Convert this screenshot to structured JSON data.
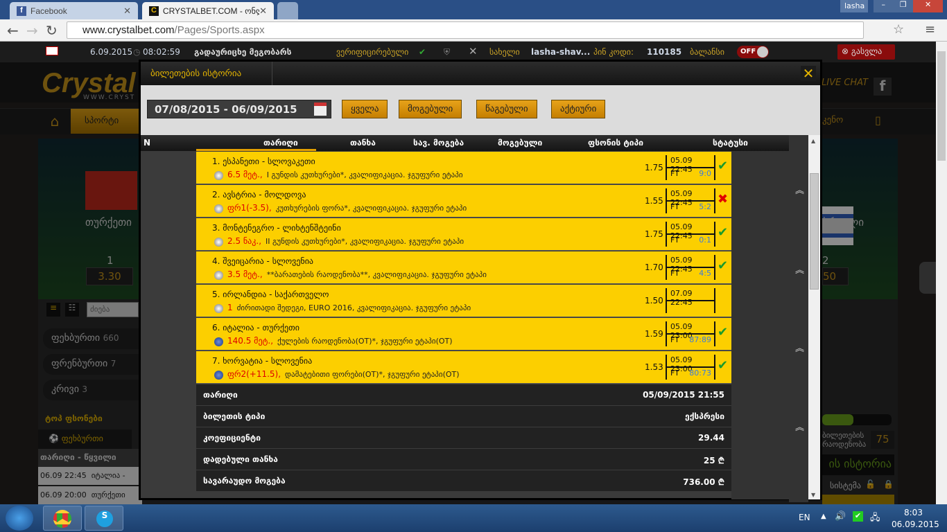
{
  "browser": {
    "tabs": [
      {
        "title": "Facebook"
      },
      {
        "title": "CRYSTALBET.COM - ონლ..."
      }
    ],
    "url_host": "www.crystalbet.com",
    "url_path": "/Pages/Sports.aspx",
    "user": "lasha"
  },
  "topbar": {
    "date": "6.09.2015",
    "time": "08:02:59",
    "transfer": "გადაურიცხე მეგობარს",
    "verified": "ვერიფიცირებული",
    "name_label": "სახელი",
    "username": "lasha-shav...",
    "pin_label": "პინ კოდი:",
    "pin": "110185",
    "balance_label": "ბალანსი",
    "balance_toggle": "OFF",
    "logout": "გასვლა"
  },
  "site": {
    "logo": "Crystal",
    "logo_sub": "WWW.CRYST",
    "nav_sport": "სპორტი",
    "nav_casino": "კენო",
    "live_chat": "LIVE CHAT",
    "team1": "თურქეთი",
    "team2": "ისრაელი",
    "odd1_label": "1",
    "odd1": "3.30",
    "odd2_label": "2",
    "odd2": "50",
    "search_placeholder": "ძიება",
    "sports": [
      {
        "name": "ფეხბურთი",
        "count": "660"
      },
      {
        "name": "ფრენბურთი",
        "count": "7"
      },
      {
        "name": "კრივი",
        "count": "3"
      }
    ],
    "top_events": "ტოპ ფსონები",
    "top_tab": "ფეხბურთი",
    "top_header": "თარიღი - წყვილი",
    "top_rows": [
      {
        "time": "06.09 22:45",
        "match": "იტალია -"
      },
      {
        "time": "06.09 20:00",
        "match": "თურქეთი"
      }
    ],
    "tickets_count_label": "ბილეთების რაოდენობა",
    "tickets_count": "75",
    "history_banner": "ის ისტორია",
    "system_tab": "სისტემა"
  },
  "modal": {
    "title": "ბილეთების ისტორია",
    "date_range": "07/08/2015 - 06/09/2015",
    "filters": [
      "ყველა",
      "მოგებული",
      "წაგებული",
      "აქტიური"
    ],
    "columns": [
      "N",
      "თარიღი",
      "თანხა",
      "სავ. მოგება",
      "მოგებული",
      "ფსონის ტიპი",
      "სტატუსი"
    ],
    "bets": [
      {
        "match": "1. ესპანეთი - სლოვაკეთი",
        "bet": "6.5 მეტ.,",
        "desc": "I გუნდის კუთხურები*, კვალიფიკაცია. ჯგუფური ეტაპი",
        "sport": "football",
        "odds": "1.75",
        "date": "05.09 22:45",
        "period": "FT",
        "score": "9:0",
        "status": "won",
        "mark": "✔"
      },
      {
        "match": "2. ავსტრია - მოლდოვა",
        "bet": "ფრ1(-3.5),",
        "desc": "კუთხურების ფორა*, კვალიფიკაცია. ჯგუფური ეტაპი",
        "sport": "football",
        "odds": "1.55",
        "date": "05.09 22:45",
        "period": "FT",
        "score": "5:2",
        "status": "lost",
        "mark": "✖"
      },
      {
        "match": "3. მონტენეგრო - ლიხტენშტეინი",
        "bet": "2.5 ნაკ.,",
        "desc": "II გუნდის კუთხურები*, კვალიფიკაცია. ჯგუფური ეტაპი",
        "sport": "football",
        "odds": "1.75",
        "date": "05.09 22:45",
        "period": "FT",
        "score": "0:1",
        "status": "won",
        "mark": "✔"
      },
      {
        "match": "4. შვეიცარია - სლოვენია",
        "bet": "3.5 მეტ.,",
        "desc": "**ბარათების რაოდენობა**, კვალიფიკაცია. ჯგუფური ეტაპი",
        "sport": "football",
        "odds": "1.70",
        "date": "05.09 22:45",
        "period": "FT",
        "score": "4:5",
        "status": "won",
        "mark": "✔"
      },
      {
        "match": "5. ირლანდია - საქართველო",
        "bet": "1",
        "desc": "ძირითადი შედეგი, EURO 2016, კვალიფიკაცია. ჯგუფური ეტაპი",
        "sport": "football",
        "odds": "1.50",
        "date": "07.09 22:45",
        "period": "",
        "score": "",
        "status": "pending",
        "mark": ""
      },
      {
        "match": "6. იტალია - თურქეთი",
        "bet": "140.5 მეტ.,",
        "desc": "ქულების რაოდენობა(OT)*, ჯგუფური ეტაპი(OT)",
        "sport": "basketball",
        "odds": "1.59",
        "date": "05.09 23:00",
        "period": "FT",
        "score": "87:89",
        "status": "won",
        "mark": "✔"
      },
      {
        "match": "7. ხორვატია - სლოვენია",
        "bet": "ფრ2(+11.5),",
        "desc": "დამატებითი ფორები(OT)*, ჯგუფური ეტაპი(OT)",
        "sport": "basketball",
        "odds": "1.53",
        "date": "05.09 23:00",
        "period": "FT",
        "score": "80:73",
        "status": "won",
        "mark": "✔"
      }
    ],
    "summary": [
      {
        "label": "თარიღი",
        "value": "05/09/2015 21:55"
      },
      {
        "label": "ბილეთის ტიპი",
        "value": "ექსპრესი"
      },
      {
        "label": "კოეფიციენტი",
        "value": "29.44"
      },
      {
        "label": "დადებული თანხა",
        "value": "25 ₾"
      },
      {
        "label": "სავარაუდო მოგება",
        "value": "736.00 ₾"
      }
    ]
  },
  "taskbar": {
    "lang": "EN",
    "time": "8:03",
    "date": "06.09.2015"
  },
  "colors": {
    "accent": "#fccf00",
    "won": "#1a9a2a",
    "lost": "#e00000",
    "score": "#3a7be0"
  }
}
